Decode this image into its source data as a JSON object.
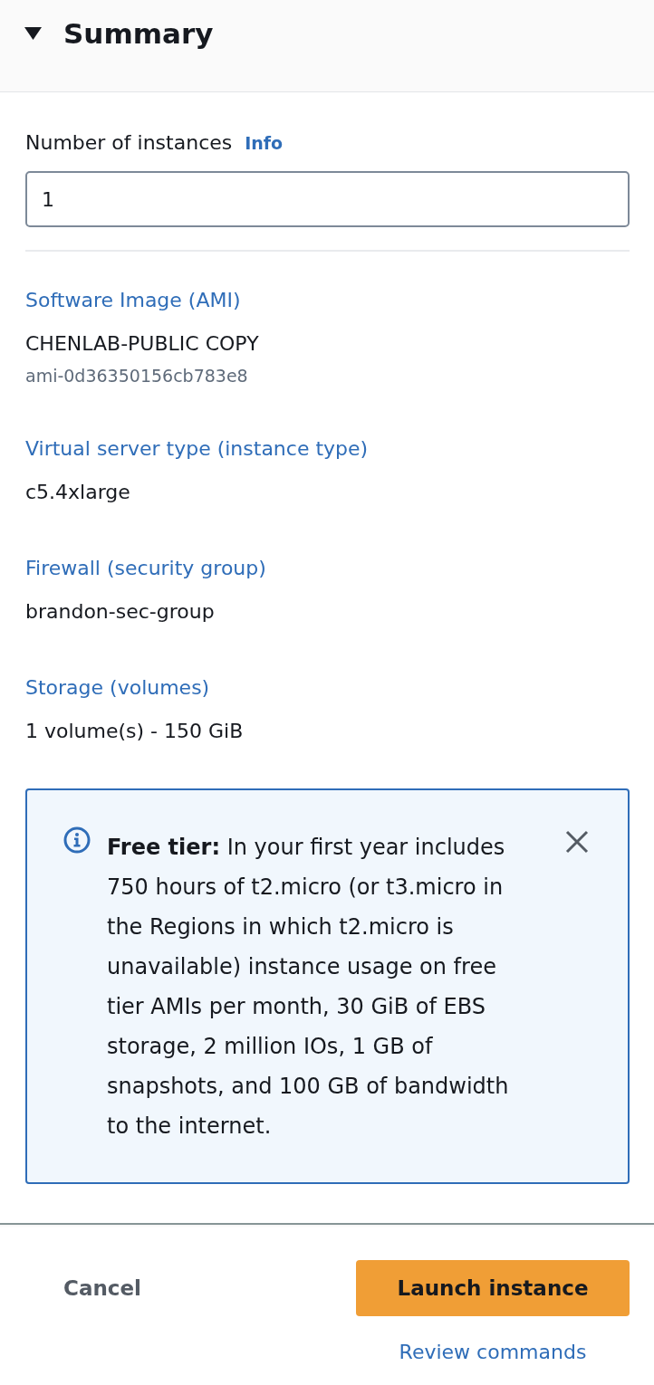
{
  "summary": {
    "title": "Summary",
    "expanded": true
  },
  "instances": {
    "label": "Number of instances",
    "info": "Info",
    "value": "1"
  },
  "details": [
    {
      "label": "Software Image (AMI)",
      "value": "CHENLAB-PUBLIC COPY",
      "sub": "ami-0d36350156cb783e8"
    },
    {
      "label": "Virtual server type (instance type)",
      "value": "c5.4xlarge"
    },
    {
      "label": "Firewall (security group)",
      "value": "brandon-sec-group"
    },
    {
      "label": "Storage (volumes)",
      "value": "1 volume(s) - 150 GiB"
    }
  ],
  "alert": {
    "text": "**Free tier:** In your first year includes 750 hours of t2.micro (or t3.micro in the Regions in which t2.micro is unavailable) instance usage on free tier AMIs per month, 30 GiB of EBS storage, 2 million IOs, 1 GB of snapshots, and 100 GB of bandwidth to the internet."
  },
  "actions": {
    "cancel": "Cancel",
    "primary": "Launch instance",
    "secondary": "Review commands"
  }
}
